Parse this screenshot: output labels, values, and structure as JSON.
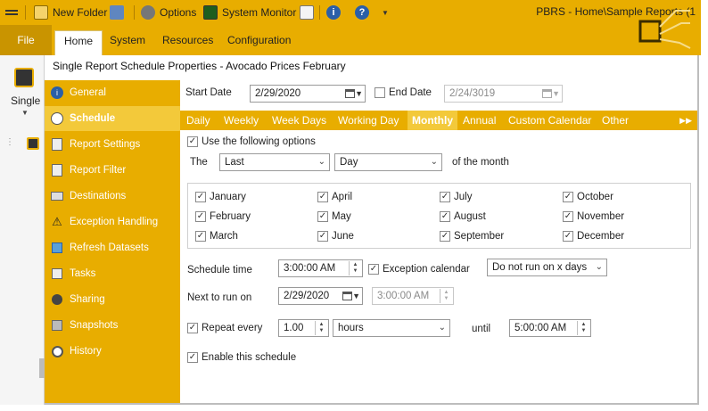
{
  "toolbar": {
    "new_folder_label": "New Folder",
    "options_label": "Options",
    "system_monitor_label": "System Monitor",
    "info_icon": "i",
    "help_icon": "?"
  },
  "app": {
    "title": "PBRS - Home\\Sample Reports (1"
  },
  "ribbon": {
    "file_label": "File",
    "tabs": [
      {
        "label": "Home"
      },
      {
        "label": "System"
      },
      {
        "label": "Resources"
      },
      {
        "label": "Configuration"
      }
    ]
  },
  "left_panel": {
    "single_label": "Single"
  },
  "dialog": {
    "title": "Single Report Schedule Properties - Avocado Prices February"
  },
  "nav": {
    "items": [
      {
        "label": "General",
        "icon": "info-icon"
      },
      {
        "label": "Schedule",
        "icon": "clock-icon"
      },
      {
        "label": "Report Settings",
        "icon": "report-settings-icon"
      },
      {
        "label": "Report Filter",
        "icon": "filter-icon"
      },
      {
        "label": "Destinations",
        "icon": "destinations-icon"
      },
      {
        "label": "Exception Handling",
        "icon": "warning-icon"
      },
      {
        "label": "Refresh Datasets",
        "icon": "refresh-icon"
      },
      {
        "label": "Tasks",
        "icon": "tasks-icon"
      },
      {
        "label": "Sharing",
        "icon": "sharing-icon"
      },
      {
        "label": "Snapshots",
        "icon": "snapshots-icon"
      },
      {
        "label": "History",
        "icon": "history-icon"
      }
    ]
  },
  "schedule": {
    "start_date_label": "Start Date",
    "start_date": "2/29/2020",
    "end_date_label": "End Date",
    "end_date": "2/24/3019",
    "end_date_checked": false,
    "frequency_tabs": [
      {
        "label": "Daily"
      },
      {
        "label": "Weekly"
      },
      {
        "label": "Week Days"
      },
      {
        "label": "Working Day"
      },
      {
        "label": "Monthly"
      },
      {
        "label": "Annual"
      },
      {
        "label": "Custom Calendar"
      },
      {
        "label": "Other"
      }
    ],
    "more_tabs_icon": "▶▶",
    "use_options_label": "Use the following options",
    "the_label": "The",
    "occurrence_value": "Last",
    "day_value": "Day",
    "of_month_label": "of  the  month",
    "months": [
      {
        "label": "January",
        "checked": true
      },
      {
        "label": "February",
        "checked": true
      },
      {
        "label": "March",
        "checked": true
      },
      {
        "label": "April",
        "checked": true
      },
      {
        "label": "May",
        "checked": true
      },
      {
        "label": "June",
        "checked": true
      },
      {
        "label": "July",
        "checked": true
      },
      {
        "label": "August",
        "checked": true
      },
      {
        "label": "September",
        "checked": true
      },
      {
        "label": "October",
        "checked": true
      },
      {
        "label": "November",
        "checked": true
      },
      {
        "label": "December",
        "checked": true
      }
    ],
    "schedule_time_label": "Schedule time",
    "schedule_time": "3:00:00 AM",
    "exception_calendar_label": "Exception calendar",
    "exception_calendar_value": "Do not run on x days",
    "next_run_label": "Next to run on",
    "next_run_date": "2/29/2020",
    "next_run_time": "3:00:00 AM",
    "repeat_every_label": "Repeat every",
    "repeat_value": "1.00",
    "repeat_unit": "hours",
    "until_label": "until",
    "until_time": "5:00:00 AM",
    "enable_label": "Enable this schedule",
    "check_mark": "✓"
  },
  "colors": {
    "accent": "#e8ad00",
    "accent_light": "#f3c93a",
    "file_button": "#c99400"
  }
}
